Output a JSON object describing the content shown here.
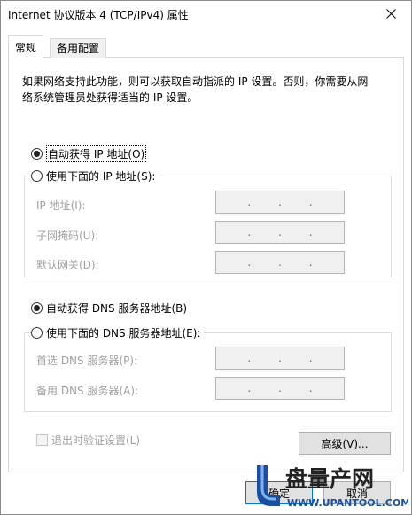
{
  "window": {
    "title": "Internet 协议版本 4 (TCP/IPv4) 属性"
  },
  "tabs": [
    {
      "label": "常规"
    },
    {
      "label": "备用配置"
    }
  ],
  "description": [
    "如果网络支持此功能，则可以获取自动指派的 IP 设置。否则，你需要从网",
    "络系统管理员处获得适当的 IP 设置。"
  ],
  "ip": {
    "auto_label": "自动获得 IP 地址(O)",
    "manual_label": "使用下面的 IP 地址(S):",
    "selected": "auto",
    "fields": [
      {
        "label": "IP 地址(I):"
      },
      {
        "label": "子网掩码(U):"
      },
      {
        "label": "默认网关(D):"
      }
    ]
  },
  "dns": {
    "auto_label": "自动获得 DNS 服务器地址(B)",
    "manual_label": "使用下面的 DNS 服务器地址(E):",
    "selected": "auto",
    "fields": [
      {
        "label": "首选 DNS 服务器(P):"
      },
      {
        "label": "备用 DNS 服务器(A):"
      }
    ]
  },
  "ip_dot": ".",
  "validate_label": "退出时验证设置(L)",
  "buttons": {
    "advanced": "高级(V)...",
    "ok": "确定",
    "cancel": "取消"
  },
  "watermark": {
    "brand": "盘量产网",
    "url": "WWW.UPANTOOL.COM"
  }
}
